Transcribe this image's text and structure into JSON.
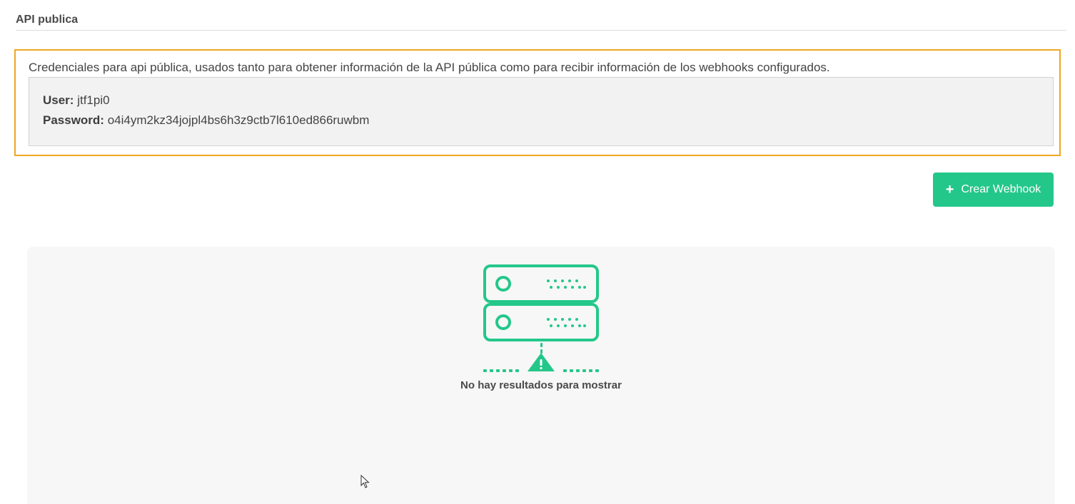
{
  "section": {
    "title": "API publica"
  },
  "credentials": {
    "description": "Credenciales para api pública, usados tanto para obtener información de la API pública como para recibir información de los webhooks configurados.",
    "user_label": "User:",
    "user_value": "jtf1pi0",
    "password_label": "Password:",
    "password_value": "o4i4ym2kz34jojpl4bs6h3z9ctb7l610ed866ruwbm"
  },
  "actions": {
    "create_webhook_icon": "plus-icon",
    "create_webhook_label": "Crear Webhook"
  },
  "empty_state": {
    "icon": "server-warning-icon",
    "message": "No hay resultados para mostrar"
  },
  "colors": {
    "accent_green": "#24c78a",
    "highlight_border": "#f0a722",
    "panel_bg": "#f7f7f7"
  }
}
